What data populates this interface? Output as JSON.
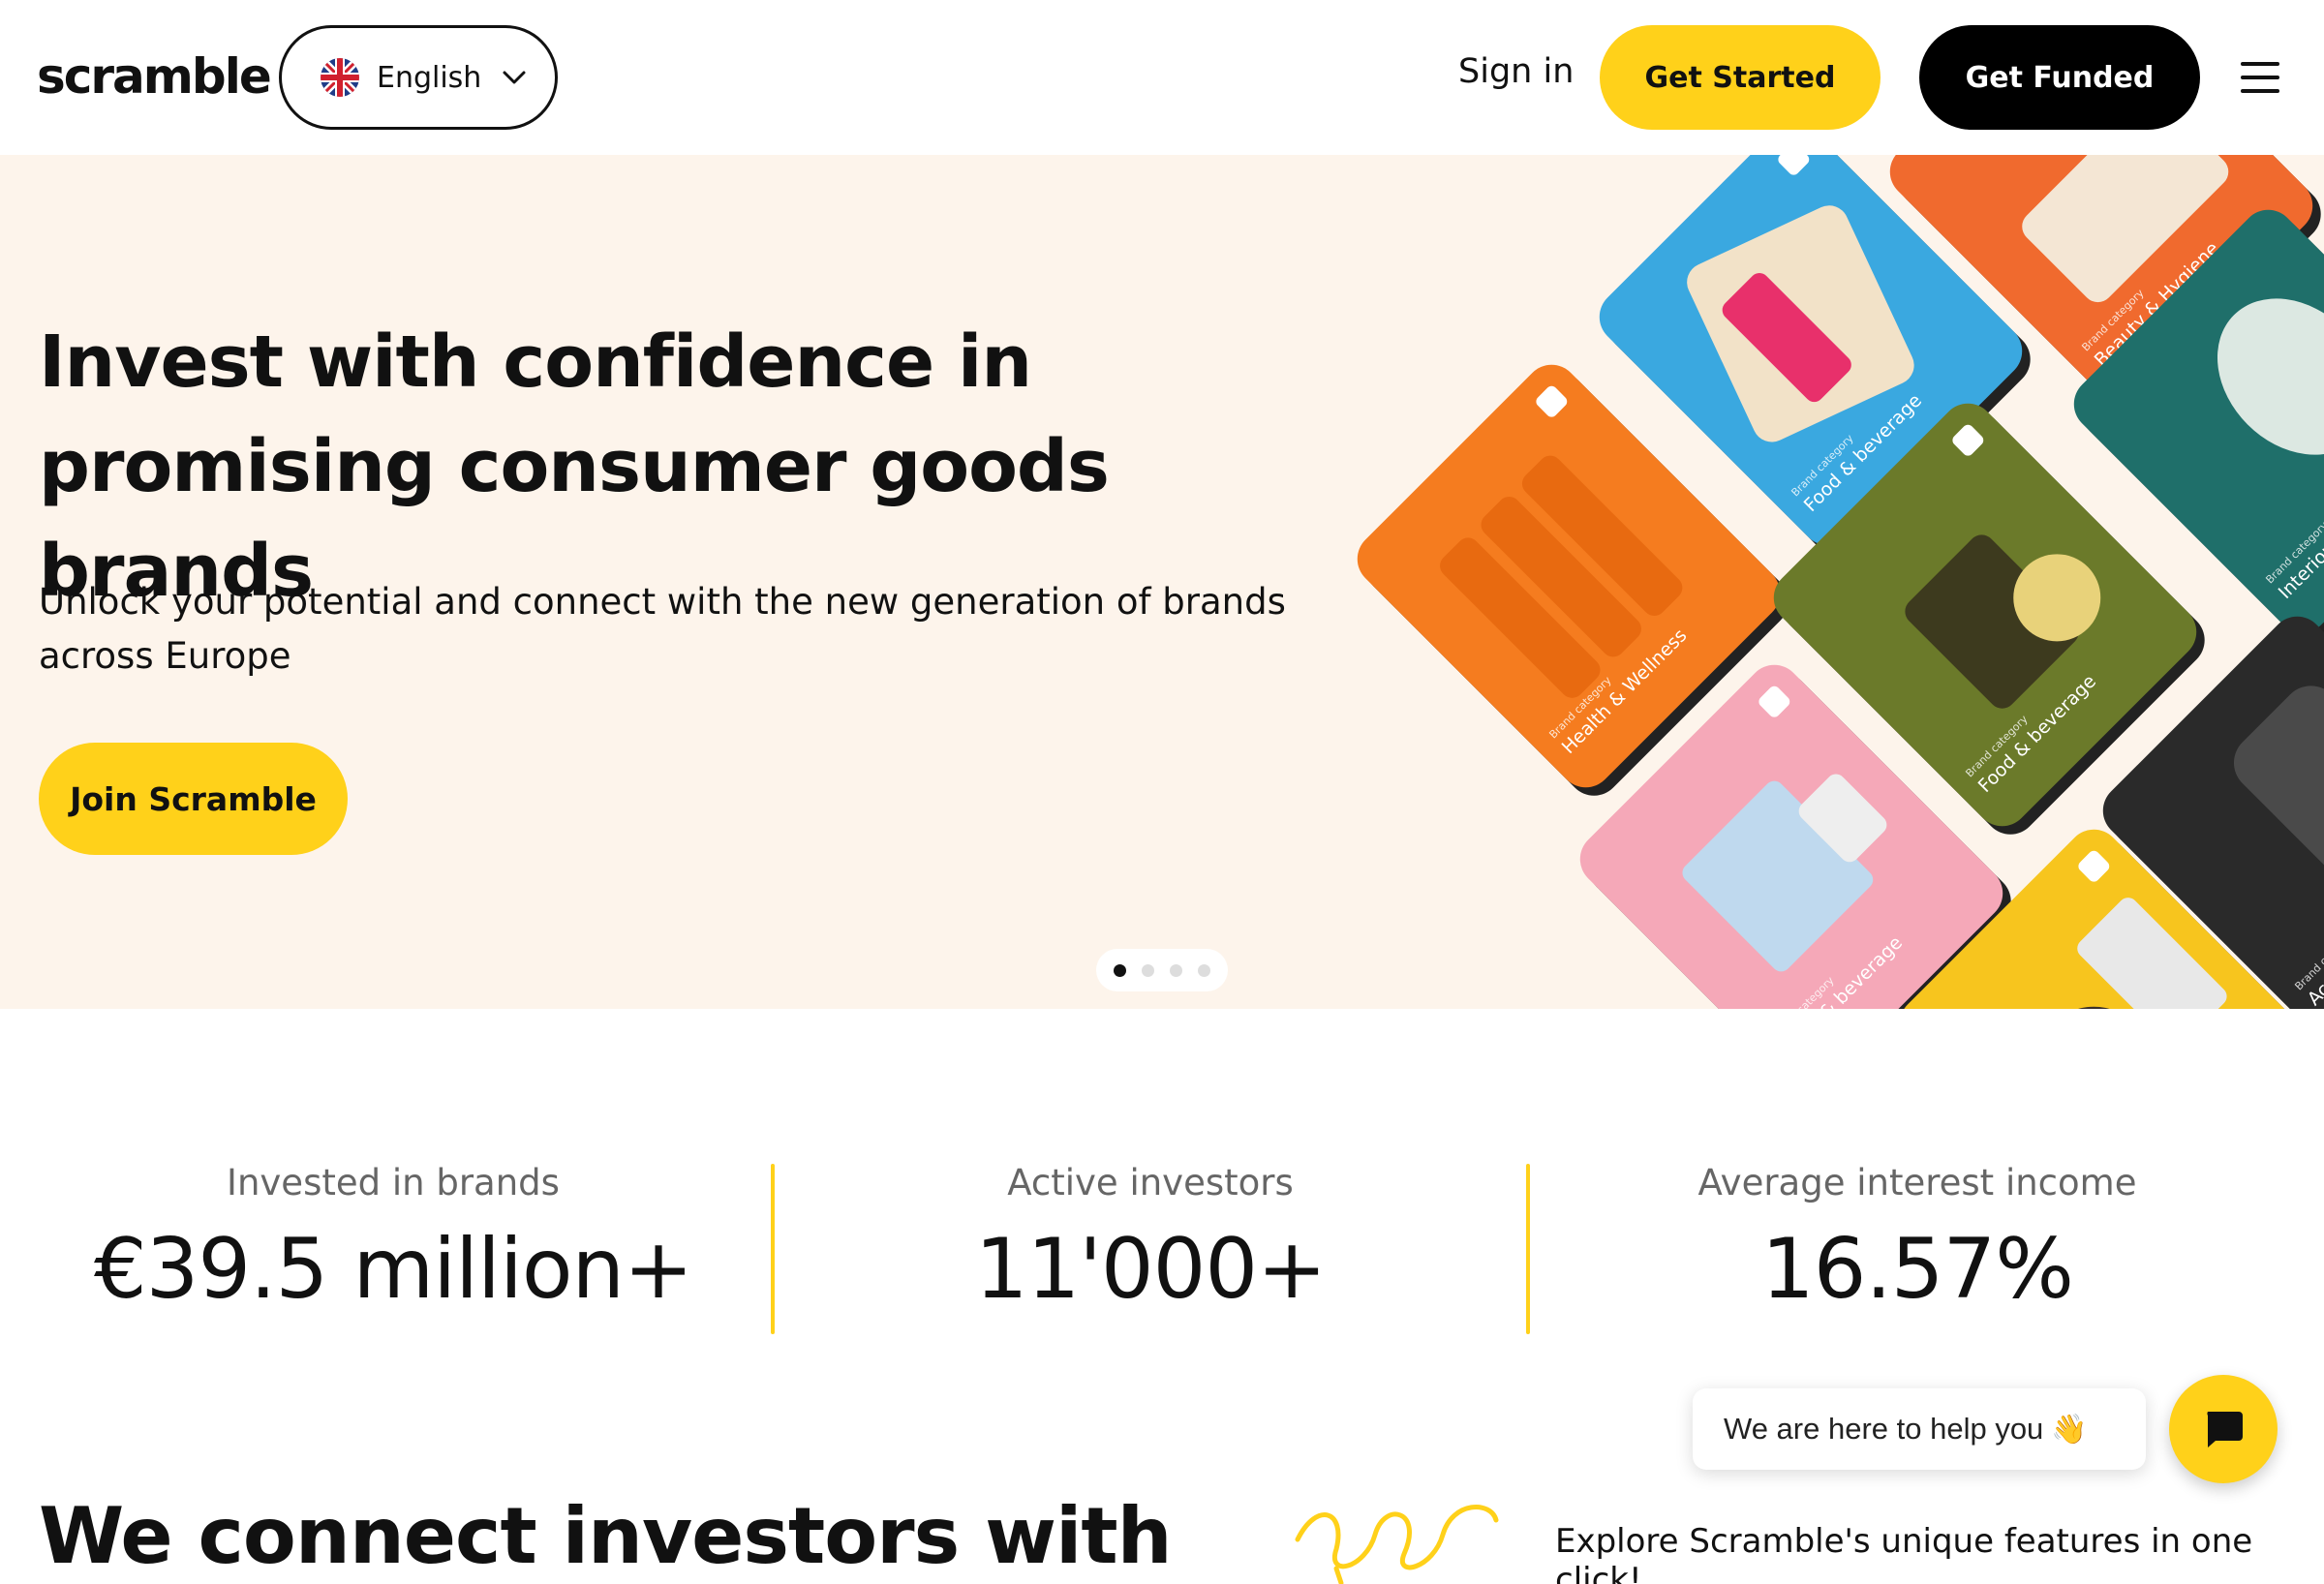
{
  "header": {
    "logo": "scramble",
    "language": "English",
    "sign_in": "Sign in",
    "get_started": "Get Started",
    "get_funded": "Get Funded"
  },
  "hero": {
    "title": "Invest with confidence in promising consumer goods brands",
    "subtitle": "Unlock your potential and connect with the new generation of brands across Europe",
    "cta": "Join Scramble",
    "carousel_active_index": 0,
    "carousel_count": 4,
    "cards": [
      {
        "small": "Brand category",
        "category": "Food & beverage",
        "color": "#3AA8E0"
      },
      {
        "small": "Brand category",
        "category": "Beauty & Hygiene",
        "color": "#F06A2E"
      },
      {
        "small": "Brand category",
        "category": "Health & Wellness",
        "color": "#F57C1F"
      },
      {
        "small": "Brand category",
        "category": "Food & beverage",
        "color": "#6B7A2A"
      },
      {
        "small": "Brand category",
        "category": "Interiors and Fashion",
        "color": "#1F6F6A"
      },
      {
        "small": "Brand category",
        "category": "Food & beverage",
        "color": "#F5A8B8"
      },
      {
        "small": "Brand category",
        "category": "Accessories",
        "color": "#2A2A2A"
      },
      {
        "small": "",
        "category": "",
        "color": "#F7C51E"
      }
    ]
  },
  "stats": [
    {
      "label": "Invested in brands",
      "value": "€39.5 million+"
    },
    {
      "label": "Active investors",
      "value": "11'000+"
    },
    {
      "label": "Average interest income",
      "value": "16.57%"
    }
  ],
  "bottom": {
    "title": "We connect investors with",
    "explore": "Explore Scramble's unique features in one click!"
  },
  "chat": {
    "bubble": "We are here to help you",
    "wave": "👋"
  },
  "colors": {
    "accent": "#FFD11A",
    "hero_bg": "#FDF4EB",
    "dark": "#000000"
  }
}
